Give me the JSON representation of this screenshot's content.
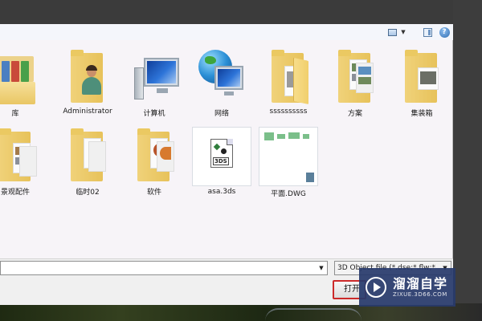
{
  "items": [
    {
      "label": "库",
      "icon": "library-icon"
    },
    {
      "label": "Administrator",
      "icon": "user-folder-icon"
    },
    {
      "label": "计算机",
      "icon": "computer-icon"
    },
    {
      "label": "网络",
      "icon": "network-icon"
    },
    {
      "label": "ssssssssss",
      "icon": "folder-icon"
    },
    {
      "label": "方案",
      "icon": "folder-icon"
    },
    {
      "label": "集装箱",
      "icon": "folder-icon"
    },
    {
      "label": "景观配件",
      "icon": "folder-icon"
    },
    {
      "label": "临时02",
      "icon": "folder-icon"
    },
    {
      "label": "软件",
      "icon": "folder-icon"
    },
    {
      "label": "asa.3ds",
      "icon": "3ds-file-icon"
    },
    {
      "label": "平面.DWG",
      "icon": "dwg-file-icon"
    }
  ],
  "bottom": {
    "filename_value": "",
    "filetype": "3D Object file (*.dse;*.flw;*",
    "open_label": "打开"
  },
  "watermark": {
    "title": "溜溜自学",
    "subtitle": "ZIXUE.3D66.COM"
  },
  "colors": {
    "folder": "#f1cf6c",
    "highlight_border": "#cc2a2a",
    "watermark_bg": "#283a6c"
  }
}
